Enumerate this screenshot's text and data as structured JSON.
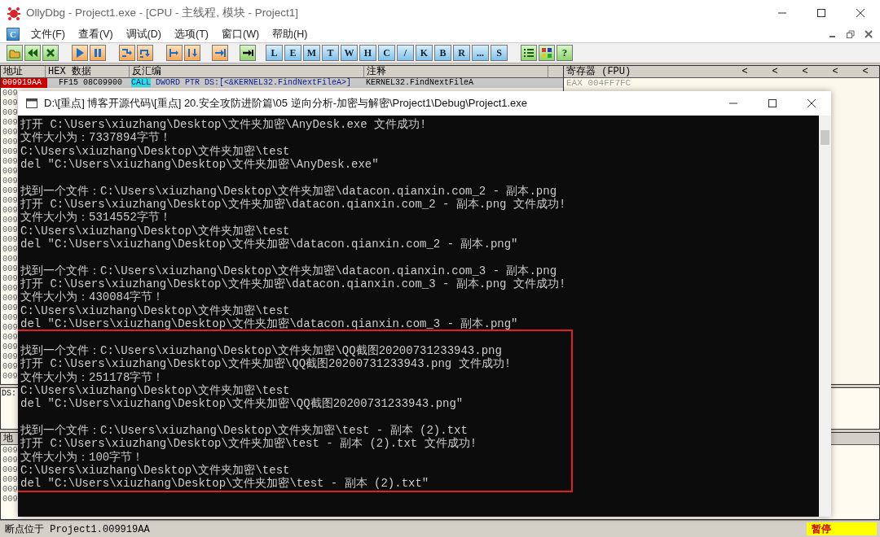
{
  "window": {
    "title": "OllyDbg - Project1.exe - [CPU - 主线程, 模块 - Project1]"
  },
  "menu": {
    "app_glyph": "C",
    "items": [
      "文件(F)",
      "查看(V)",
      "调试(D)",
      "选项(T)",
      "窗口(W)",
      "帮助(H)"
    ]
  },
  "toolbar": {
    "letters": [
      "L",
      "E",
      "M",
      "T",
      "W",
      "H",
      "C",
      "/",
      "K",
      "B",
      "R",
      "...",
      "S"
    ],
    "help": "?"
  },
  "disasm": {
    "columns": [
      "地址",
      "HEX 数据",
      "反汇编",
      "注释"
    ],
    "rows": [
      {
        "address": "009919AA",
        "hex": "FF15 08C09900",
        "mnemonic": "CALL",
        "operand": "DWORD PTR DS:[<&KERNEL32.FindNextFileA>]",
        "comment": "KERNEL32.FindNextFileA",
        "selected": true
      }
    ],
    "address_fragments": [
      "009",
      "009",
      "009",
      "009",
      "009",
      "009",
      "009",
      "009",
      "009",
      "009",
      "009",
      "009",
      "009",
      "009",
      "009",
      "009",
      "009",
      "009",
      "009",
      "009",
      "009",
      "009",
      "009",
      "009",
      "009",
      "009",
      "009",
      "009",
      "009",
      "009"
    ]
  },
  "registers": {
    "title": "寄存器 (FPU)",
    "arrows": [
      "<",
      "<",
      "<",
      "<",
      "<"
    ],
    "lines": [
      "EAX 004FF7FC"
    ]
  },
  "info": {
    "text": "DS:"
  },
  "dump": {
    "column": "地",
    "address_fragments": [
      "009",
      "009",
      "009",
      "009",
      "009",
      "009"
    ]
  },
  "console": {
    "title": "D:\\[重点] 博客开源代码\\[重点] 20.安全攻防进阶篇\\05 逆向分析-加密与解密\\Project1\\Debug\\Project1.exe",
    "sections": [
      {
        "highlighted": false,
        "blocks": [
          [
            "打开 C:\\Users\\xiuzhang\\Desktop\\文件夹加密\\AnyDesk.exe 文件成功!",
            "文件大小为：7337894字节！",
            "C:\\Users\\xiuzhang\\Desktop\\文件夹加密\\test",
            "del \"C:\\Users\\xiuzhang\\Desktop\\文件夹加密\\AnyDesk.exe\""
          ],
          [
            "找到一个文件：C:\\Users\\xiuzhang\\Desktop\\文件夹加密\\datacon.qianxin.com_2 - 副本.png",
            "打开 C:\\Users\\xiuzhang\\Desktop\\文件夹加密\\datacon.qianxin.com_2 - 副本.png 文件成功!",
            "文件大小为：5314552字节！",
            "C:\\Users\\xiuzhang\\Desktop\\文件夹加密\\test",
            "del \"C:\\Users\\xiuzhang\\Desktop\\文件夹加密\\datacon.qianxin.com_2 - 副本.png\""
          ],
          [
            "找到一个文件：C:\\Users\\xiuzhang\\Desktop\\文件夹加密\\datacon.qianxin.com_3 - 副本.png",
            "打开 C:\\Users\\xiuzhang\\Desktop\\文件夹加密\\datacon.qianxin.com_3 - 副本.png 文件成功!",
            "文件大小为：430084字节！",
            "C:\\Users\\xiuzhang\\Desktop\\文件夹加密\\test",
            "del \"C:\\Users\\xiuzhang\\Desktop\\文件夹加密\\datacon.qianxin.com_3 - 副本.png\""
          ]
        ]
      },
      {
        "highlighted": true,
        "blocks": [
          [
            "找到一个文件：C:\\Users\\xiuzhang\\Desktop\\文件夹加密\\QQ截图20200731233943.png",
            "打开 C:\\Users\\xiuzhang\\Desktop\\文件夹加密\\QQ截图20200731233943.png 文件成功!",
            "文件大小为：251178字节！",
            "C:\\Users\\xiuzhang\\Desktop\\文件夹加密\\test",
            "del \"C:\\Users\\xiuzhang\\Desktop\\文件夹加密\\QQ截图20200731233943.png\""
          ],
          [
            "找到一个文件：C:\\Users\\xiuzhang\\Desktop\\文件夹加密\\test - 副本 (2).txt",
            "打开 C:\\Users\\xiuzhang\\Desktop\\文件夹加密\\test - 副本 (2).txt 文件成功!",
            "文件大小为：100字节！",
            "C:\\Users\\xiuzhang\\Desktop\\文件夹加密\\test",
            "del \"C:\\Users\\xiuzhang\\Desktop\\文件夹加密\\test - 副本 (2).txt\""
          ]
        ]
      }
    ]
  },
  "status_bar": {
    "message": "断点位于 Project1.009919AA",
    "state": "暂停"
  }
}
